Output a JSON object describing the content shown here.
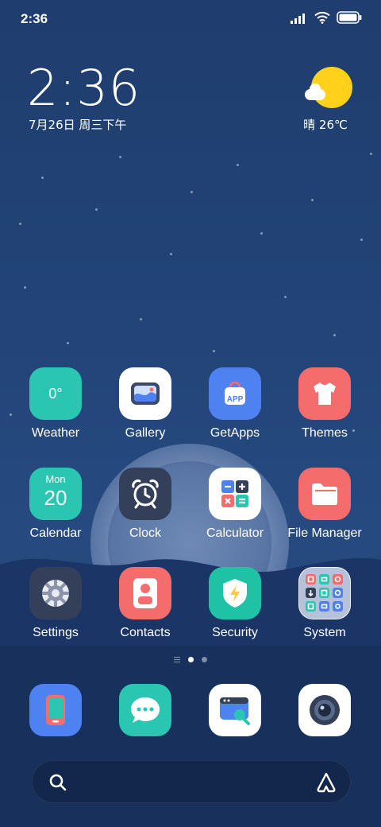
{
  "status_bar": {
    "time": "2:36",
    "signal_icon": "signal-icon",
    "wifi_icon": "wifi-icon",
    "battery_icon": "battery-icon"
  },
  "clock_widget": {
    "time": "2:36",
    "date": "7月26日 周三下午"
  },
  "weather_widget": {
    "icon": "sun-cloud-icon",
    "text": "晴 26℃"
  },
  "apps": {
    "weather": {
      "label": "Weather",
      "icon_text": "0°",
      "color": "#2bc6b2"
    },
    "gallery": {
      "label": "Gallery",
      "color": "#ffffff"
    },
    "getapps": {
      "label": "GetApps",
      "icon_text": "APP",
      "color": "#4e82f0"
    },
    "themes": {
      "label": "Themes",
      "color": "#f56c6c"
    },
    "calendar": {
      "label": "Calendar",
      "day_name": "Mon",
      "day_number": "20",
      "color": "#2bc6b2"
    },
    "clock": {
      "label": "Clock",
      "color": "#34405a"
    },
    "calculator": {
      "label": "Calculator",
      "color": "#ffffff"
    },
    "file_manager": {
      "label": "File Manager",
      "color": "#f56c6c"
    },
    "settings": {
      "label": "Settings",
      "color": "#34405a"
    },
    "contacts": {
      "label": "Contacts",
      "color": "#f56c6c"
    },
    "security": {
      "label": "Security",
      "color": "#20c2a6"
    },
    "system": {
      "label": "System",
      "color": "#c8d2e6"
    }
  },
  "dock": {
    "phone": {
      "icon": "phone-icon",
      "color": "#4e82f0"
    },
    "messages": {
      "icon": "messages-icon",
      "color": "#2bc6b2"
    },
    "browser": {
      "icon": "browser-icon",
      "color": "#ffffff"
    },
    "camera": {
      "icon": "camera-icon",
      "color": "#ffffff"
    }
  },
  "page_indicator": {
    "pages": 2,
    "active": 1
  },
  "search": {
    "search_icon": "search-icon",
    "assistant_icon": "assistant-icon"
  }
}
